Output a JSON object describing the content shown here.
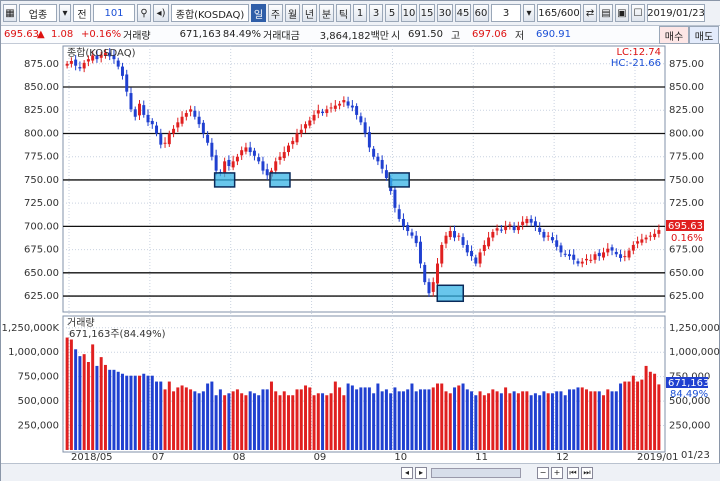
{
  "toolbar": {
    "market_select": "업종",
    "code_field": "전",
    "code_value": "101",
    "code_name": "종합(KOSDAQ)",
    "periods": [
      "일",
      "주",
      "월",
      "년",
      "분",
      "틱"
    ],
    "minutes": [
      "1",
      "3",
      "5",
      "10",
      "15",
      "30",
      "45",
      "60"
    ],
    "interval_value": "3",
    "count": "165/600",
    "date": "2019/01/23"
  },
  "infobar": {
    "price": "695.63",
    "change_arrow": "▲",
    "change": "1.08",
    "change_pct": "+0.16%",
    "volume_label": "거래량",
    "volume": "671,163",
    "volume_ratio": "84.49%",
    "amount_label": "거래대금",
    "amount": "3,864,182백만",
    "open_label": "시",
    "open": "691.50",
    "high_label": "고",
    "high": "697.06",
    "low_label": "저",
    "low": "690.91",
    "buy_button": "매수",
    "sell_button": "매도"
  },
  "price_panel": {
    "title": "종합(KOSDAQ)",
    "lc_label": "LC:12.74",
    "hc_label": "HC:-21.66",
    "current_price_tag": "695.63",
    "current_pct_tag": "0.16%",
    "colors": {
      "up": "#e02020",
      "down": "#2040d0",
      "highlight_box": "#35b3e6"
    }
  },
  "volume_panel": {
    "title": "거래량",
    "subtitle": "671,163주(84.49%)",
    "current_volume_tag": "671,163",
    "current_ratio_tag": "84.49%"
  },
  "bottom_right_label": "01/23",
  "chart_data": {
    "type": "candlestick",
    "price_axis": {
      "ticks": [
        625,
        650,
        675,
        700,
        725,
        750,
        775,
        800,
        825,
        850,
        875
      ],
      "tick_labels": [
        "625.00",
        "650.00",
        "675.00",
        "700.00",
        "725.00",
        "750.00",
        "775.00",
        "800.00",
        "825.00",
        "850.00",
        "875.00"
      ],
      "ylim": [
        610,
        892
      ]
    },
    "volume_axis": {
      "ticks": [
        250000,
        500000,
        750000,
        1000000,
        1250000
      ],
      "tick_labels": [
        "250,000",
        "500,000",
        "750,000",
        "1,000,000",
        "1,250,000K"
      ],
      "ylim": [
        0,
        1350000
      ]
    },
    "x_labels": [
      "2018/05",
      "07",
      "08",
      "09",
      "10",
      "11",
      "12",
      "2019/01"
    ],
    "reference_lines": [
      625,
      650,
      700,
      750,
      800,
      850
    ],
    "highlight_boxes": [
      {
        "price": 750
      },
      {
        "price": 750
      },
      {
        "price": 750
      },
      {
        "price": 628
      }
    ],
    "close_series": [
      875,
      878,
      873,
      870,
      876,
      880,
      884,
      880,
      885,
      887,
      883,
      880,
      872,
      862,
      845,
      826,
      818,
      832,
      820,
      812,
      810,
      800,
      788,
      790,
      800,
      805,
      812,
      818,
      822,
      826,
      818,
      810,
      800,
      790,
      775,
      760,
      757,
      770,
      765,
      770,
      775,
      782,
      785,
      780,
      776,
      770,
      760,
      755,
      760,
      770,
      775,
      780,
      787,
      792,
      800,
      804,
      810,
      814,
      820,
      825,
      822,
      826,
      828,
      830,
      832,
      836,
      830,
      828,
      820,
      812,
      800,
      785,
      775,
      770,
      762,
      752,
      738,
      720,
      708,
      700,
      695,
      690,
      682,
      660,
      640,
      628,
      640,
      660,
      680,
      690,
      695,
      688,
      690,
      680,
      672,
      668,
      660,
      672,
      680,
      688,
      694,
      698,
      696,
      700,
      702,
      696,
      700,
      705,
      708,
      704,
      700,
      694,
      688,
      690,
      685,
      678,
      672,
      670,
      668,
      664,
      660,
      662,
      665,
      664,
      670,
      668,
      672,
      676,
      674,
      670,
      666,
      668,
      674,
      680,
      684,
      686,
      688,
      690,
      692,
      696
    ]
  },
  "chart_data_volume_series": [
    1150,
    1130,
    1030,
    960,
    980,
    900,
    1080,
    860,
    950,
    870,
    820,
    820,
    800,
    780,
    760,
    760,
    760,
    760,
    780,
    760,
    760,
    700,
    700,
    620,
    700,
    600,
    640,
    660,
    640,
    620,
    600,
    580,
    600,
    680,
    700,
    560,
    620,
    560,
    580,
    600,
    620,
    580,
    560,
    600,
    580,
    560,
    620,
    620,
    700,
    600,
    560,
    600,
    560,
    560,
    620,
    620,
    660,
    640,
    560,
    580,
    580,
    560,
    580,
    700,
    640,
    560,
    680,
    660,
    620,
    640,
    640,
    640,
    580,
    680,
    600,
    620,
    580,
    640,
    600,
    600,
    620,
    680,
    600,
    620,
    620,
    620,
    640,
    680,
    680,
    600,
    580,
    640,
    660,
    680,
    620,
    600,
    560,
    600,
    560,
    580,
    620,
    600,
    580,
    640,
    580,
    600,
    580,
    600,
    600,
    560,
    580,
    560,
    600,
    580,
    580,
    600,
    600,
    560,
    620,
    620,
    640,
    640,
    620,
    600,
    600,
    600,
    560,
    620,
    600,
    600,
    680,
    700,
    700,
    760,
    700,
    720,
    860,
    800,
    780,
    671
  ]
}
